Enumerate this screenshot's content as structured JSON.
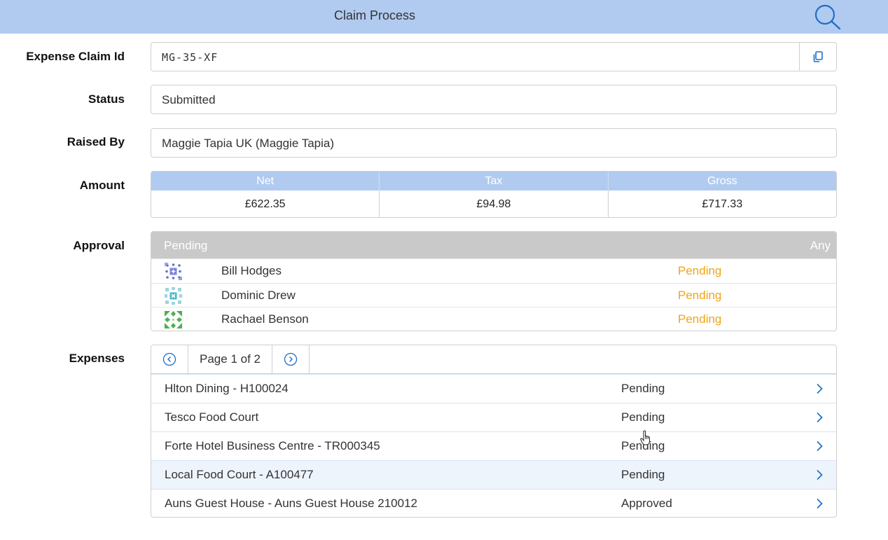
{
  "header": {
    "title": "Claim Process",
    "search_icon": "search-icon"
  },
  "fields": {
    "claim_id": {
      "label": "Expense Claim Id",
      "value": "MG-35-XF",
      "copy_icon": "copy-icon"
    },
    "status": {
      "label": "Status",
      "value": "Submitted"
    },
    "raised_by": {
      "label": "Raised By",
      "value": "Maggie Tapia UK (Maggie Tapia)"
    }
  },
  "amount": {
    "label": "Amount",
    "headers": [
      "Net",
      "Tax",
      "Gross"
    ],
    "values": [
      "£622.35",
      "£94.98",
      "£717.33"
    ]
  },
  "approval": {
    "label": "Approval",
    "header_left": "Pending",
    "header_right": "Any",
    "status_color": "#f0a418",
    "approvers": [
      {
        "name": "Bill Hodges",
        "status": "Pending",
        "avatar": "identicon-avatar-purple"
      },
      {
        "name": "Dominic Drew",
        "status": "Pending",
        "avatar": "identicon-avatar-teal"
      },
      {
        "name": "Rachael Benson",
        "status": "Pending",
        "avatar": "identicon-avatar-green"
      }
    ]
  },
  "expenses": {
    "label": "Expenses",
    "pager": {
      "text": "Page 1 of 2",
      "prev_icon": "chevron-left-circle-icon",
      "next_icon": "chevron-right-circle-icon"
    },
    "items": [
      {
        "name": "Hlton Dining - H100024",
        "status": "Pending"
      },
      {
        "name": "Tesco Food Court",
        "status": "Pending"
      },
      {
        "name": "Forte Hotel Business Centre - TR000345",
        "status": "Pending"
      },
      {
        "name": "Local Food Court - A100477",
        "status": "Pending"
      },
      {
        "name": "Auns Guest House - Auns Guest House 210012",
        "status": "Approved"
      }
    ]
  },
  "colors": {
    "header_bg": "#b1cbf0",
    "accent_blue": "#1f6fc5",
    "pending_orange": "#f0a418",
    "approval_header_bg": "#c9c9c9"
  }
}
